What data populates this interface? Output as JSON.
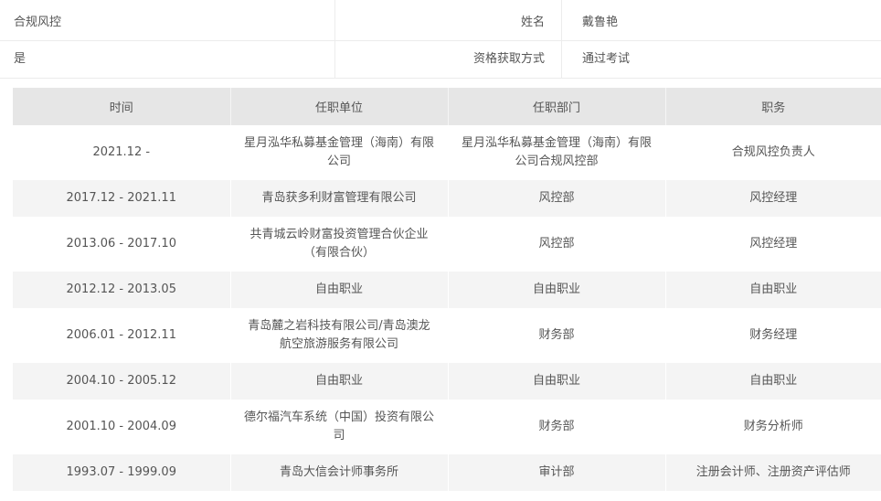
{
  "info": [
    {
      "left": "合规风控",
      "label": "姓名",
      "value": "戴鲁艳"
    },
    {
      "left": "是",
      "label": "资格获取方式",
      "value": "通过考试"
    }
  ],
  "table": {
    "headers": [
      "时间",
      "任职单位",
      "任职部门",
      "职务"
    ],
    "rows": [
      {
        "time": "2021.12 -",
        "unit": "星月泓华私募基金管理（海南）有限公司",
        "dept": "星月泓华私募基金管理（海南）有限公司合规风控部",
        "title": "合规风控负责人"
      },
      {
        "time": "2017.12 - 2021.11",
        "unit": "青岛获多利财富管理有限公司",
        "dept": "风控部",
        "title": "风控经理"
      },
      {
        "time": "2013.06 - 2017.10",
        "unit": "共青城云岭财富投资管理合伙企业（有限合伙）",
        "dept": "风控部",
        "title": "风控经理"
      },
      {
        "time": "2012.12 - 2013.05",
        "unit": "自由职业",
        "dept": "自由职业",
        "title": "自由职业"
      },
      {
        "time": "2006.01 - 2012.11",
        "unit": "青岛麓之岩科技有限公司/青岛澳龙航空旅游服务有限公司",
        "dept": "财务部",
        "title": "财务经理"
      },
      {
        "time": "2004.10 - 2005.12",
        "unit": "自由职业",
        "dept": "自由职业",
        "title": "自由职业"
      },
      {
        "time": "2001.10 - 2004.09",
        "unit": "德尔福汽车系统（中国）投资有限公司",
        "dept": "财务部",
        "title": "财务分析师"
      },
      {
        "time": "1993.07 - 1999.09",
        "unit": "青岛大信会计师事务所",
        "dept": "审计部",
        "title": "注册会计师、注册资产评估师"
      }
    ]
  }
}
